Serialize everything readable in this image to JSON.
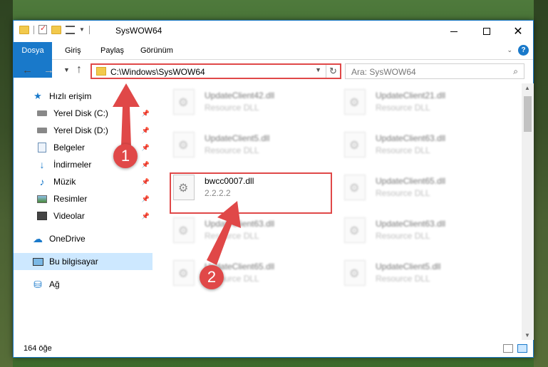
{
  "window": {
    "title": "SysWOW64",
    "controls": {
      "minimize": "minimize-icon",
      "maximize": "maximize-icon",
      "close": "close-icon"
    }
  },
  "ribbon": {
    "tabs": [
      "Dosya",
      "Giriş",
      "Paylaş",
      "Görünüm"
    ],
    "help": "?"
  },
  "navbar": {
    "address": "C:\\Windows\\SysWOW64",
    "search_placeholder": "Ara: SysWOW64"
  },
  "sidebar": {
    "items": [
      {
        "label": "Hızlı erişim",
        "icon": "star-icon"
      },
      {
        "label": "Yerel Disk (C:)",
        "icon": "disk-icon",
        "pinned": true
      },
      {
        "label": "Yerel Disk (D:)",
        "icon": "disk-icon",
        "pinned": true
      },
      {
        "label": "Belgeler",
        "icon": "document-icon",
        "pinned": true
      },
      {
        "label": "İndirmeler",
        "icon": "download-icon",
        "pinned": true
      },
      {
        "label": "Müzik",
        "icon": "music-icon",
        "pinned": true
      },
      {
        "label": "Resimler",
        "icon": "pictures-icon",
        "pinned": true
      },
      {
        "label": "Videolar",
        "icon": "videos-icon",
        "pinned": true
      },
      {
        "label": "OneDrive",
        "icon": "cloud-icon"
      },
      {
        "label": "Bu bilgisayar",
        "icon": "computer-icon",
        "selected": true
      },
      {
        "label": "Ağ",
        "icon": "network-icon"
      }
    ]
  },
  "files": [
    {
      "name": "UpdateClient42.dll",
      "desc": "Resource DLL"
    },
    {
      "name": "UpdateClient21.dll",
      "desc": "Resource DLL"
    },
    {
      "name": "UpdateClient5.dll",
      "desc": "Resource DLL"
    },
    {
      "name": "UpdateClient63.dll",
      "desc": "Resource DLL"
    },
    {
      "name": "bwcc0007.dll",
      "desc": "2.2.2.2"
    },
    {
      "name": "UpdateClient65.dll",
      "desc": "Resource DLL"
    },
    {
      "name": "UpdateClient63.dll",
      "desc": "Resource DLL"
    },
    {
      "name": "UpdateClient63.dll",
      "desc": "Resource DLL"
    },
    {
      "name": "UpdateClient65.dll",
      "desc": "Resource DLL"
    },
    {
      "name": "UpdateClient5.dll",
      "desc": "Resource DLL"
    }
  ],
  "status": {
    "count": "164 öğe"
  },
  "annotations": {
    "marker1": "1",
    "marker2": "2",
    "color": "#e04848"
  }
}
